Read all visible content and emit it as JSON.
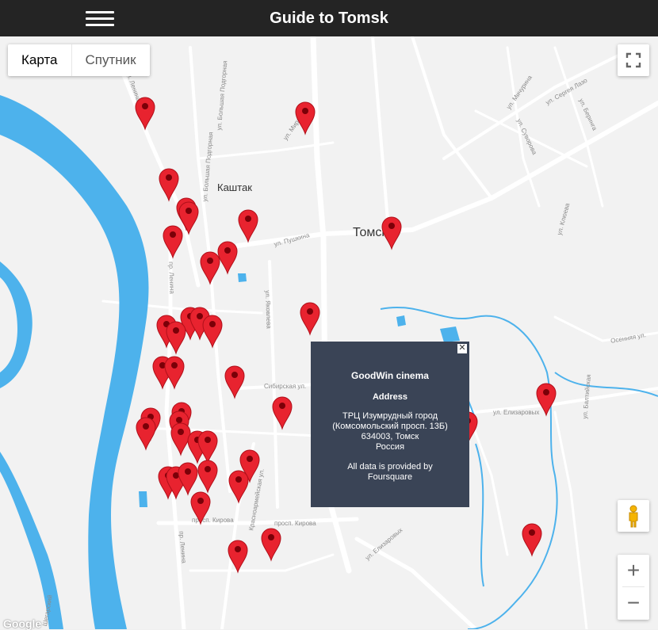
{
  "header": {
    "title": "Guide to Tomsk",
    "menu_icon": "hamburger-icon"
  },
  "map_type": {
    "map_label": "Карта",
    "satellite_label": "Спутник",
    "selected": "Карта"
  },
  "place_labels": {
    "kashtak": "Каштак",
    "city": "Томск"
  },
  "street_labels": {
    "lenina_n": "ул. Ленина",
    "bolshaya_podgornaya": "ул. Большая Подгорная",
    "bolshaya_podgornaya2": "ул. Большая Подгорная",
    "mira": "ул. Мира",
    "pushkina": "ул. Пушкина",
    "yakovleva": "ул. Яковлева",
    "lenina_s": "пр. Ленина",
    "sibirskaya": "Сибирская ул.",
    "kirova": "просп. Кирова",
    "kirova2": "просп. Кирова",
    "krasnoarmeyskaya": "Красноармейская ул.",
    "elizarovykh": "ул. Елизаровых",
    "elizarovykh2": "ул. Елизаровых",
    "michurina": "ул. Мичурина",
    "suvorova": "ул. Суворова",
    "beringa": "ул. Беринга",
    "lazo": "ул. Сергея Лазо",
    "klyueva": "ул. Клюева",
    "baltiyskaya": "ул. Балтийская",
    "osennya": "Осенняя ул.",
    "lenina_far": "пр. Ленина",
    "shegarsky": "Шегарский"
  },
  "info_window": {
    "venue": "GoodWin cinema",
    "address_label": "Address",
    "address_lines": [
      "ТРЦ Изумрудный город",
      "(Комсомольский просп. 13Б)",
      "634003, Томск",
      "Россия"
    ],
    "credit_lines": [
      "All data is provided by",
      "Foursquare"
    ],
    "close_icon": "close-icon"
  },
  "controls": {
    "fullscreen_icon": "fullscreen-icon",
    "pegman_icon": "pegman-icon",
    "zoom_in": "+",
    "zoom_out": "−"
  },
  "attribution": "Google",
  "colors": {
    "header_bg": "#242424",
    "river": "#4db2ec",
    "marker": "#e8232f",
    "info_bg": "#3a4456",
    "map_bg": "#f2f2f2"
  }
}
